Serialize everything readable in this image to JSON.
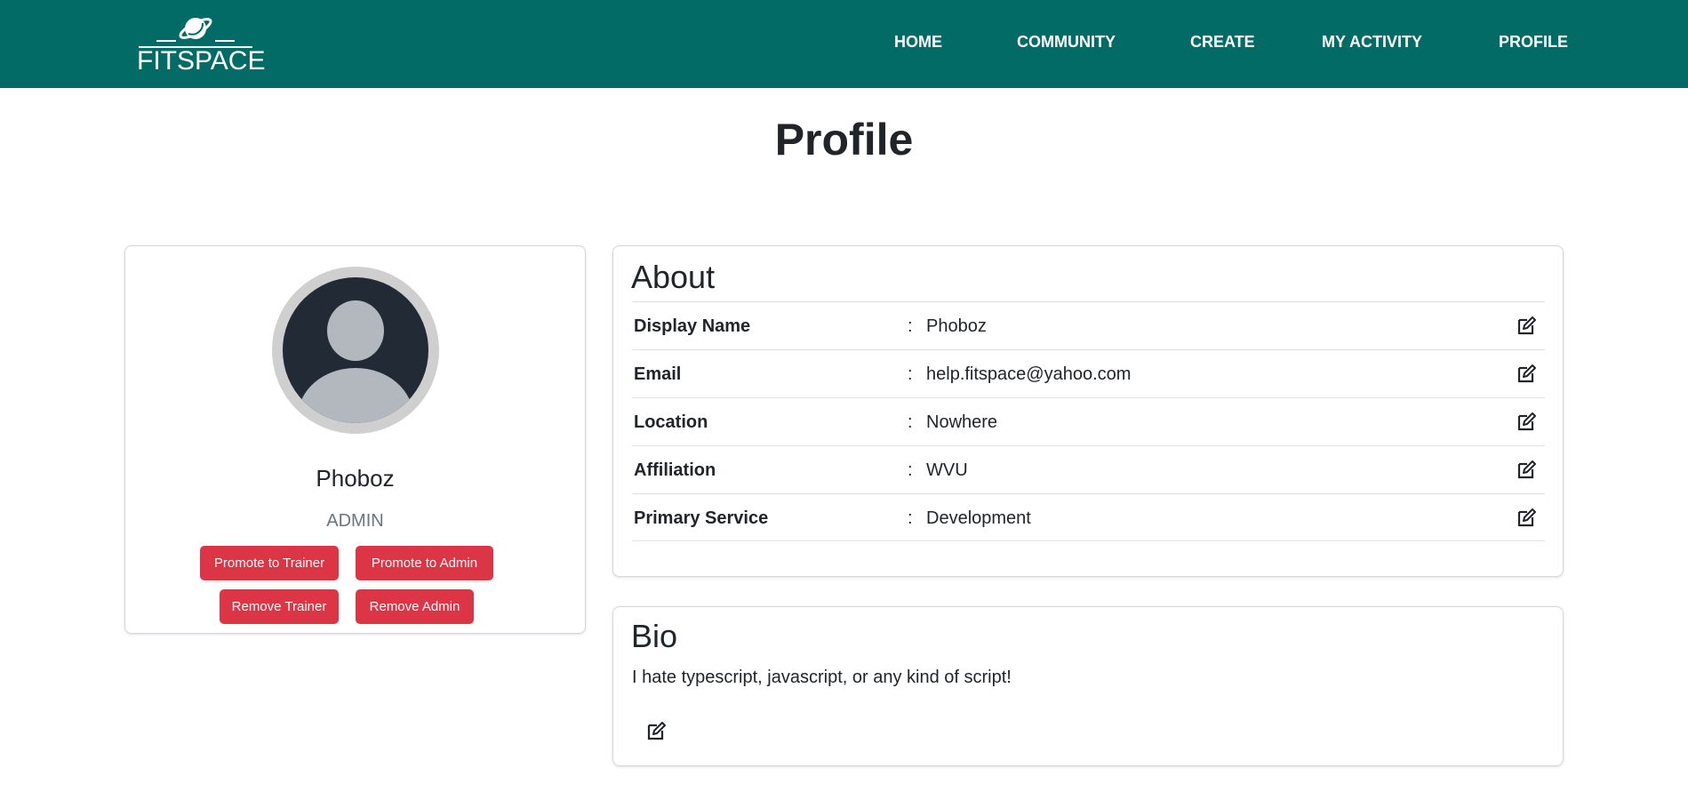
{
  "header": {
    "logo_text": "FITSPACE",
    "nav": [
      {
        "label": "HOME"
      },
      {
        "label": "COMMUNITY"
      },
      {
        "label": "CREATE"
      },
      {
        "label": "MY ACTIVITY"
      },
      {
        "label": "PROFILE"
      }
    ]
  },
  "page": {
    "title": "Profile"
  },
  "user_card": {
    "name": "Phoboz",
    "role": "ADMIN",
    "avatar_icon": "user-silhouette-icon",
    "buttons": {
      "promote_trainer": "Promote to Trainer",
      "promote_admin": "Promote to Admin",
      "remove_trainer": "Remove Trainer",
      "remove_admin": "Remove Admin"
    }
  },
  "about": {
    "title": "About",
    "rows": [
      {
        "label": "Display Name",
        "value": "Phoboz"
      },
      {
        "label": "Email",
        "value": "help.fitspace@yahoo.com"
      },
      {
        "label": "Location",
        "value": "Nowhere"
      },
      {
        "label": "Affiliation",
        "value": "WVU"
      },
      {
        "label": "Primary Service",
        "value": "Development"
      }
    ],
    "separator": ":",
    "edit_icon": "edit-icon"
  },
  "bio": {
    "title": "Bio",
    "text": "I hate typescript, javascript, or any kind of script!",
    "edit_icon": "edit-icon"
  },
  "colors": {
    "navbar": "#036b66",
    "danger": "#dc3545",
    "muted": "#6c757d"
  }
}
